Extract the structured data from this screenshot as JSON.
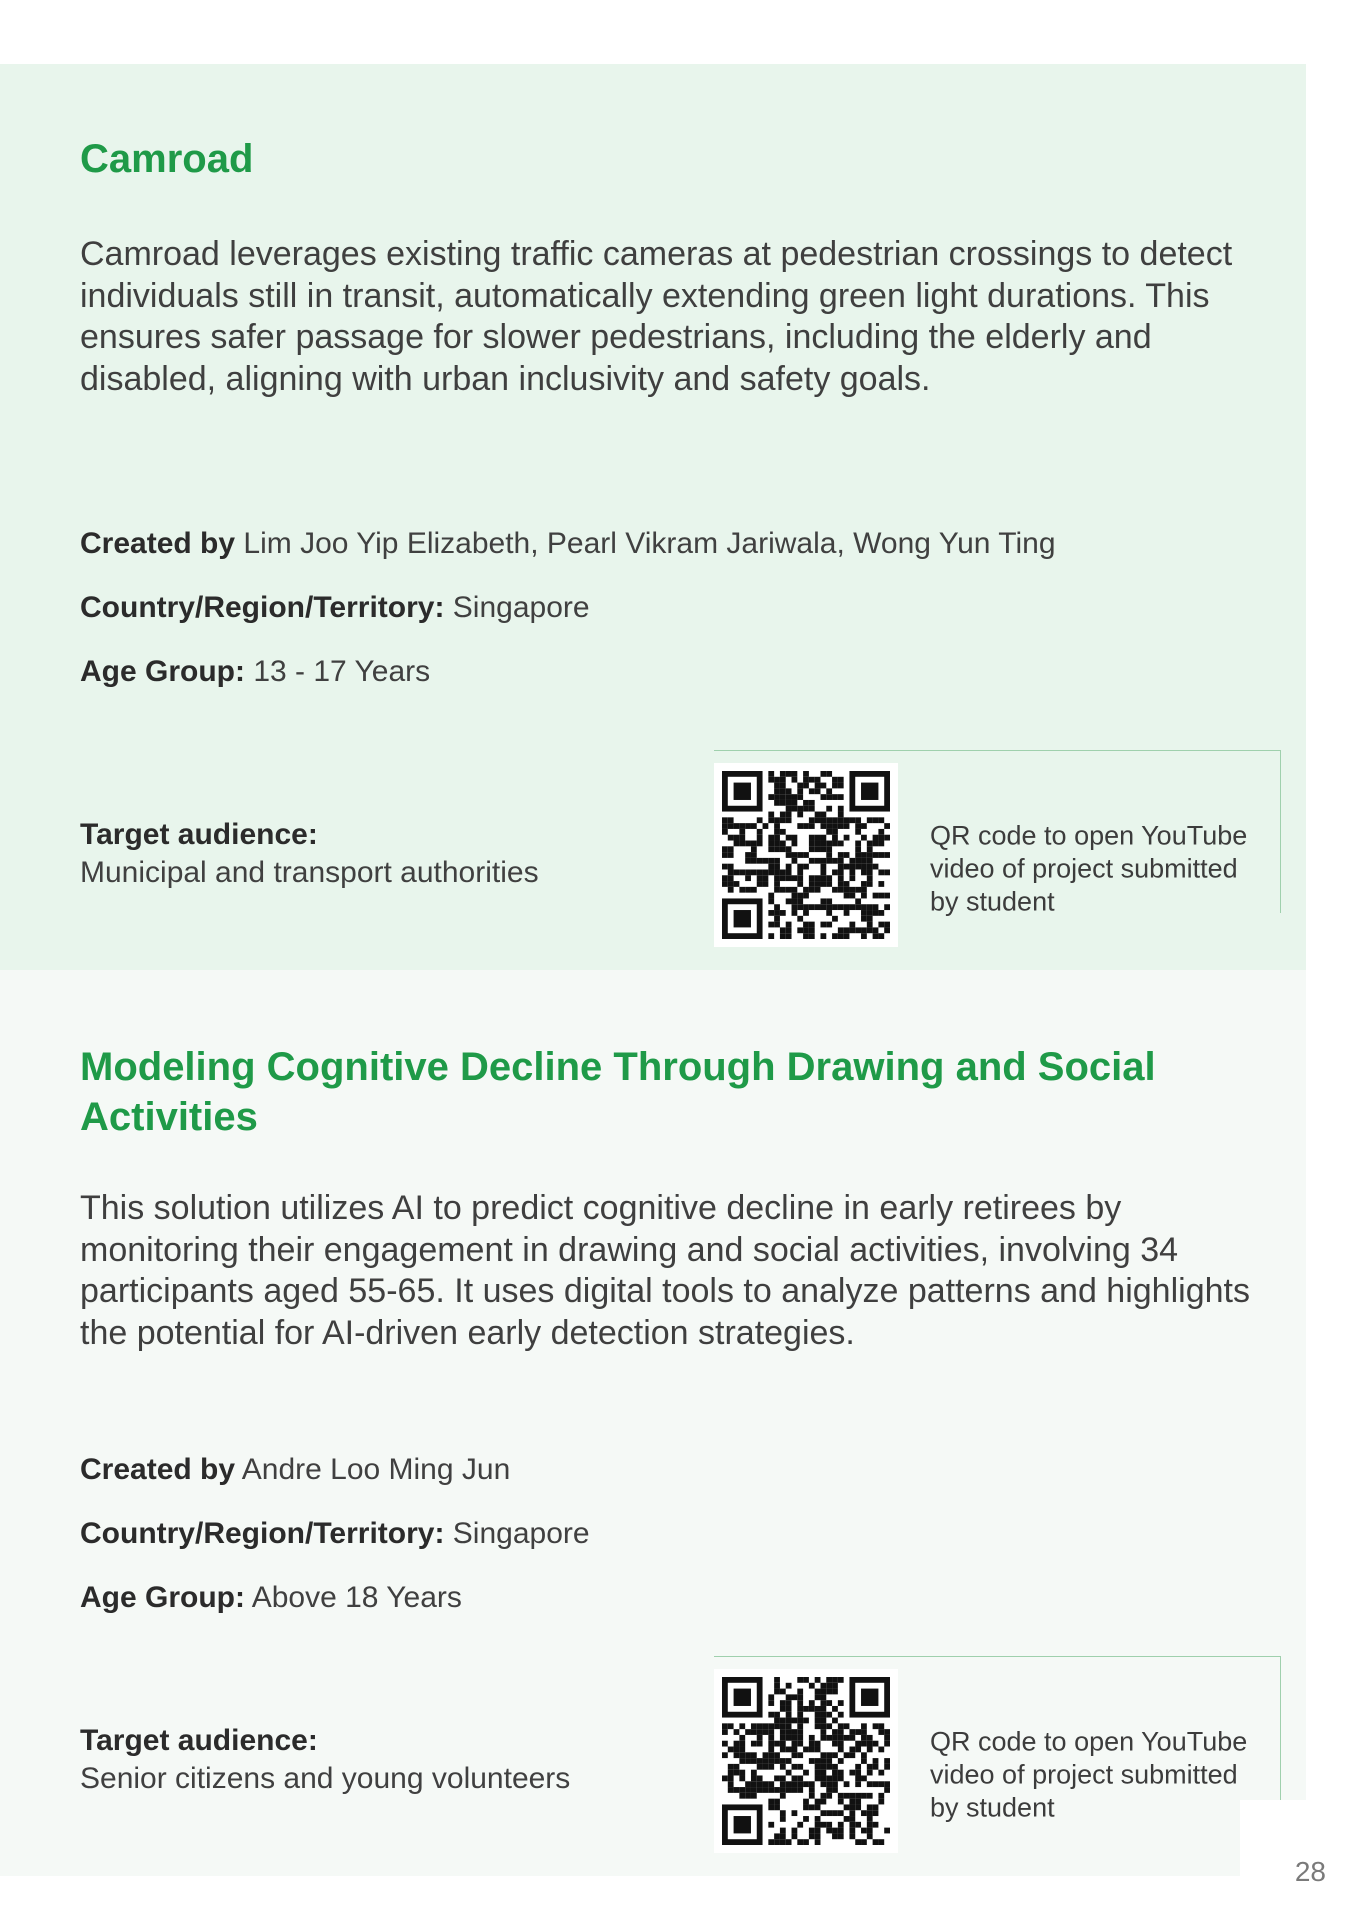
{
  "projects": [
    {
      "title": "Camroad",
      "description": "Camroad leverages existing traffic cameras at pedestrian crossings to detect individuals still in transit, automatically extending green light durations. This ensures safer passage for slower pedestrians, including the elderly and disabled, aligning with urban inclusivity and safety goals.",
      "created_by_label": "Created by",
      "created_by": "Lim Joo Yip Elizabeth, Pearl Vikram Jariwala, Wong Yun Ting",
      "country_label": "Country/Region/Territory:",
      "country": "Singapore",
      "age_label": "Age Group:",
      "age_group": "13 - 17 Years",
      "audience_label": "Target audience:",
      "audience": "Municipal and transport authorities",
      "qr_caption": "QR code to open YouTube video of project submitted by student"
    },
    {
      "title": "Modeling Cognitive Decline Through Drawing and Social Activities",
      "description": "This solution utilizes AI to predict cognitive decline in early retirees by monitoring their engagement in drawing and social activities, involving 34 participants aged 55-65. It uses digital tools to analyze patterns and highlights the potential for AI-driven early detection strategies.",
      "created_by_label": "Created by",
      "created_by": "Andre Loo Ming Jun",
      "country_label": "Country/Region/Territory:",
      "country": "Singapore",
      "age_label": "Age Group:",
      "age_group": "Above 18 Years",
      "audience_label": "Target audience:",
      "audience": "Senior citizens and young volunteers",
      "qr_caption": "QR code to open YouTube video of project submitted by student"
    }
  ],
  "page_number": "28",
  "colors": {
    "title_green": "#1f9a48",
    "card1_bg": "#e8f5ec",
    "card2_bg": "#f5f9f6",
    "qr_border": "#9fd0ad"
  },
  "icons": [
    "qr-code-icon"
  ]
}
